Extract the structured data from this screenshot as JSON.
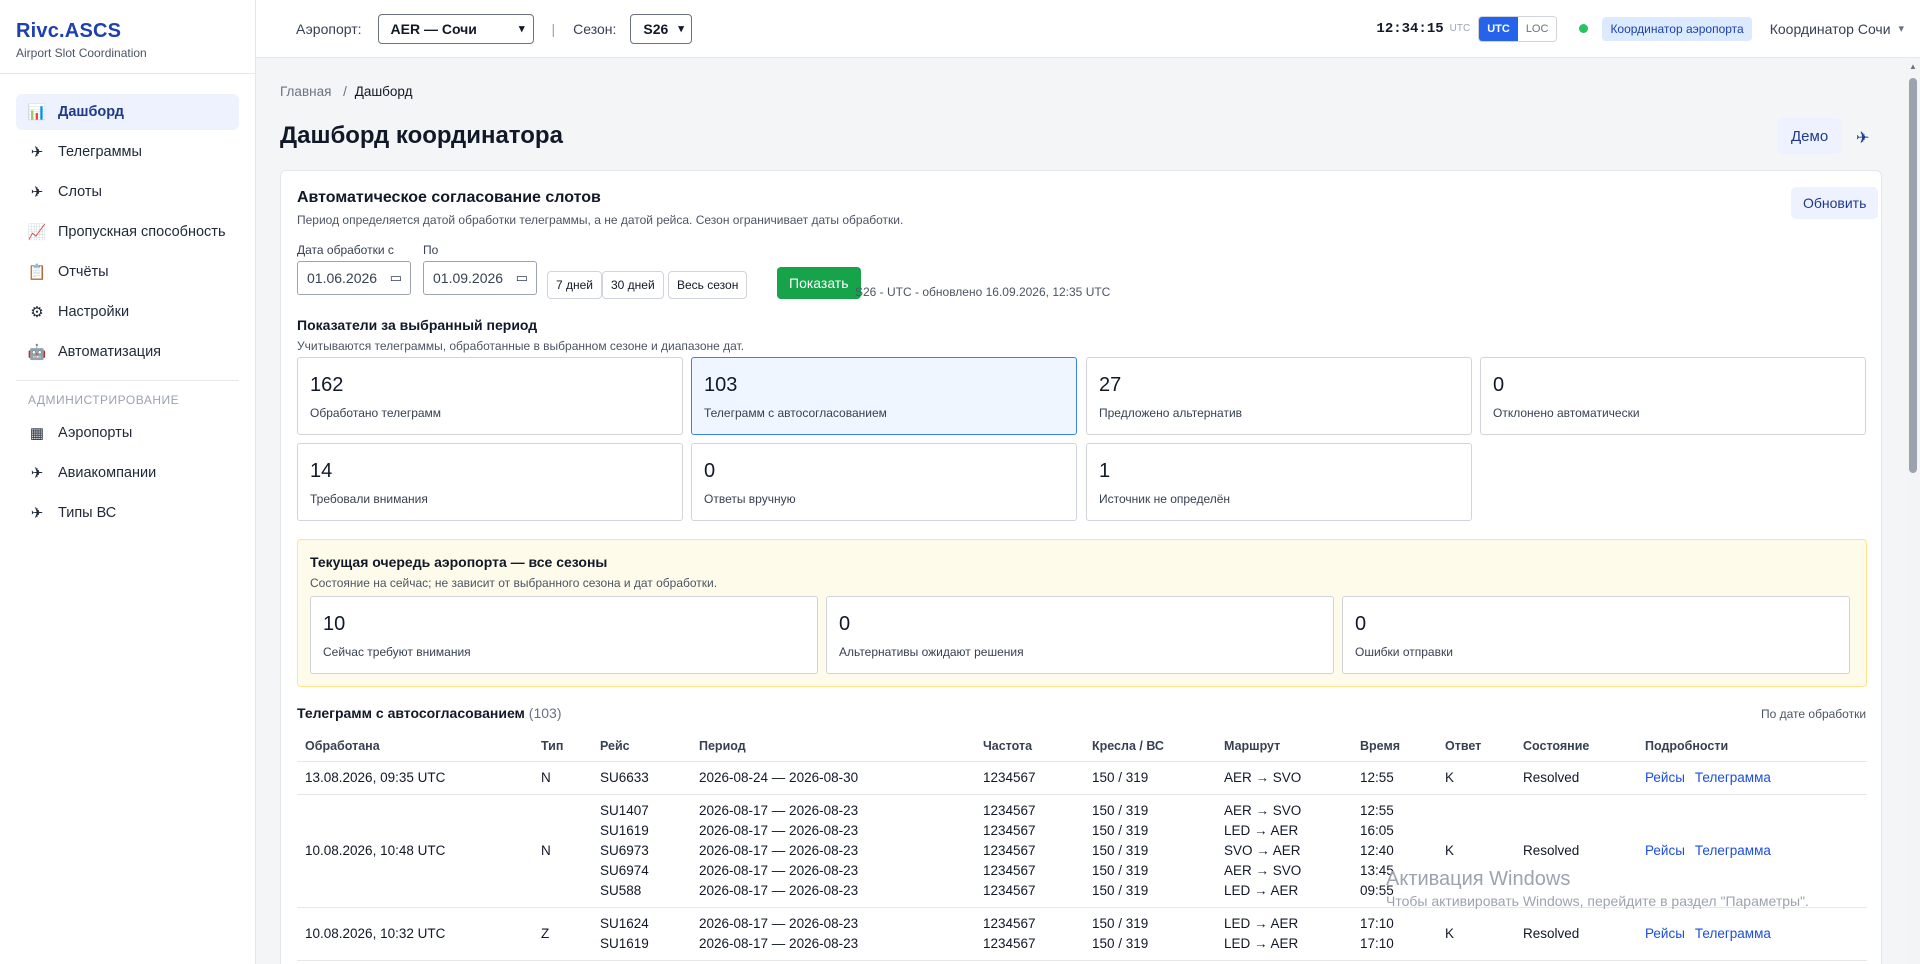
{
  "brand": {
    "title": "Rivc.ASCS",
    "subtitle": "Airport Slot Coordination"
  },
  "sidebar": {
    "items": [
      {
        "label": "Дашборд",
        "icon": "chart-icon",
        "glyph": "📊"
      },
      {
        "label": "Телеграммы",
        "icon": "plane-icon",
        "glyph": "✈"
      },
      {
        "label": "Слоты",
        "icon": "plane-icon",
        "glyph": "✈"
      },
      {
        "label": "Пропускная способность",
        "icon": "trend-icon",
        "glyph": "📈"
      },
      {
        "label": "Отчёты",
        "icon": "clipboard-icon",
        "glyph": "📋"
      },
      {
        "label": "Настройки",
        "icon": "gear-icon",
        "glyph": "⚙"
      },
      {
        "label": "Автоматизация",
        "icon": "robot-icon",
        "glyph": "🤖"
      }
    ],
    "admin_section": "АДМИНИСТРИРОВАНИЕ",
    "admin_items": [
      {
        "label": "Аэропорты",
        "icon": "grid-icon",
        "glyph": "▦"
      },
      {
        "label": "Авиакомпании",
        "icon": "plane-icon",
        "glyph": "✈"
      },
      {
        "label": "Типы ВС",
        "icon": "plane-icon",
        "glyph": "✈"
      }
    ]
  },
  "topbar": {
    "airport_label": "Аэропорт:",
    "airport_value": "AER — Сочи",
    "separator": "|",
    "season_label": "Сезон:",
    "season_value": "S26",
    "clock": "12:34:15",
    "clock_zone": "UTC",
    "tz_utc": "UTC",
    "tz_loc": "LOC",
    "role": "Координатор аэропорта",
    "user": "Координатор Сочи"
  },
  "breadcrumb": {
    "home": "Главная",
    "sep": "/",
    "current": "Дашборд"
  },
  "page": {
    "title": "Дашборд координатора",
    "demo": "Демо"
  },
  "auto": {
    "title": "Автоматическое согласование слотов",
    "subtitle": "Период определяется датой обработки телеграммы, а не датой рейса. Сезон ограничивает даты обработки.",
    "refresh": "Обновить",
    "from_label": "Дата обработки с",
    "to_label": "По",
    "from_value": "01.06.2026",
    "to_value": "01.09.2026",
    "btn_7": "7 дней",
    "btn_30": "30 дней",
    "btn_season": "Весь сезон",
    "btn_show": "Показать",
    "update_note": "S26 - UTC - обновлено 16.09.2026, 12:35 UTC"
  },
  "metrics": {
    "title": "Показатели за выбранный период",
    "subtitle": "Учитываются телеграммы, обработанные в выбранном сезоне и диапазоне дат.",
    "items": [
      {
        "value": "162",
        "label": "Обработано телеграмм"
      },
      {
        "value": "103",
        "label": "Телеграмм с автосогласованием"
      },
      {
        "value": "27",
        "label": "Предложено альтернатив"
      },
      {
        "value": "0",
        "label": "Отклонено автоматически"
      },
      {
        "value": "14",
        "label": "Требовали внимания"
      },
      {
        "value": "0",
        "label": "Ответы вручную"
      },
      {
        "value": "1",
        "label": "Источник не определён"
      }
    ]
  },
  "queue": {
    "title": "Текущая очередь аэропорта — все сезоны",
    "subtitle": "Состояние на сейчас; не зависит от выбранного сезона и дат обработки.",
    "items": [
      {
        "value": "10",
        "label": "Сейчас требуют внимания"
      },
      {
        "value": "0",
        "label": "Альтернативы ожидают решения"
      },
      {
        "value": "0",
        "label": "Ошибки отправки"
      }
    ]
  },
  "table": {
    "title": "Телеграмм с автосогласованием",
    "count": "(103)",
    "sort": "По дате обработки",
    "columns": [
      "Обработана",
      "Тип",
      "Рейс",
      "Период",
      "Частота",
      "Кресла / ВС",
      "Маршрут",
      "Время",
      "Ответ",
      "Состояние",
      "Подробности"
    ],
    "link_flights": "Рейсы",
    "link_telegram": "Телеграмма",
    "rows": [
      {
        "processed": "13.08.2026, 09:35 UTC",
        "type": "N",
        "answer": "K",
        "state": "Resolved",
        "flights": [
          "SU6633"
        ],
        "periods": [
          "2026-08-24 — 2026-08-30"
        ],
        "freqs": [
          "1234567"
        ],
        "seats": [
          "150 / 319"
        ],
        "routes": [
          "AER → SVO"
        ],
        "times": [
          "12:55"
        ]
      },
      {
        "processed": "10.08.2026, 10:48 UTC",
        "type": "N",
        "answer": "K",
        "state": "Resolved",
        "flights": [
          "SU1407",
          "SU1619",
          "SU6973",
          "SU6974",
          "SU588"
        ],
        "periods": [
          "2026-08-17 — 2026-08-23",
          "2026-08-17 — 2026-08-23",
          "2026-08-17 — 2026-08-23",
          "2026-08-17 — 2026-08-23",
          "2026-08-17 — 2026-08-23"
        ],
        "freqs": [
          "1234567",
          "1234567",
          "1234567",
          "1234567",
          "1234567"
        ],
        "seats": [
          "150 / 319",
          "150 / 319",
          "150 / 319",
          "150 / 319",
          "150 / 319"
        ],
        "routes": [
          "AER → SVO",
          "LED → AER",
          "SVO → AER",
          "AER → SVO",
          "LED → AER"
        ],
        "times": [
          "12:55",
          "16:05",
          "12:40",
          "13:45",
          "09:55"
        ]
      },
      {
        "processed": "10.08.2026, 10:32 UTC",
        "type": "Z",
        "answer": "K",
        "state": "Resolved",
        "flights": [
          "SU1624",
          "SU1619"
        ],
        "periods": [
          "2026-08-17 — 2026-08-23",
          "2026-08-17 — 2026-08-23"
        ],
        "freqs": [
          "1234567",
          "1234567"
        ],
        "seats": [
          "150 / 319",
          "150 / 319"
        ],
        "routes": [
          "LED → AER",
          "LED → AER"
        ],
        "times": [
          "17:10",
          "17:10"
        ]
      }
    ]
  },
  "watermark": {
    "line1": "Активация Windows",
    "line2": "Чтобы активировать Windows, перейдите в раздел \"Параметры\"."
  }
}
